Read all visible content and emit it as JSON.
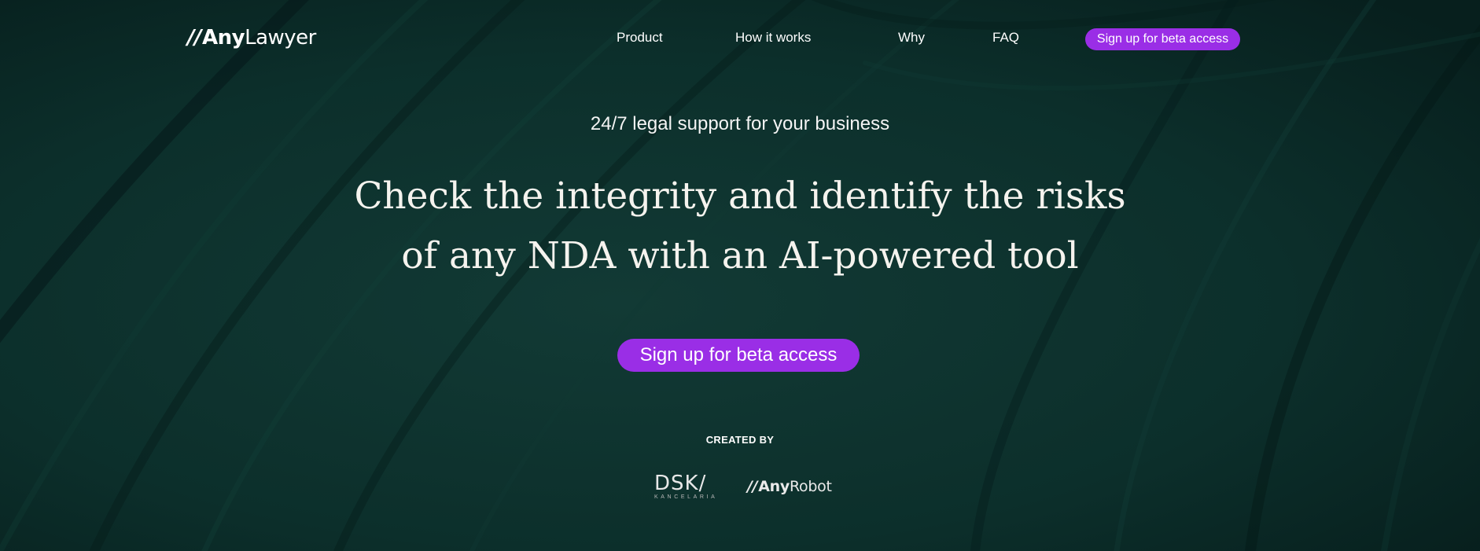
{
  "brand": {
    "logo_slashes": "//",
    "logo_bold": "Any",
    "logo_light": "Lawyer"
  },
  "nav": {
    "items": [
      {
        "label": "Product"
      },
      {
        "label": "How it works"
      },
      {
        "label": "Why"
      },
      {
        "label": "FAQ"
      }
    ],
    "cta_label": "Sign up for beta access"
  },
  "hero": {
    "tagline": "24/7 legal support for your business",
    "headline_line1": "Check the integrity and identify the risks",
    "headline_line2": "of any NDA with an AI-powered tool",
    "cta_label": "Sign up for beta access"
  },
  "credits": {
    "label": "CREATED BY",
    "dsk_main": "DSK/",
    "dsk_sub": "KANCELARIA",
    "anyrobot_slashes": "//",
    "anyrobot_bold": "Any",
    "anyrobot_light": "Robot"
  },
  "colors": {
    "background": "#0b2b28",
    "accent": "#9a2ee6",
    "text": "#ffffff"
  }
}
